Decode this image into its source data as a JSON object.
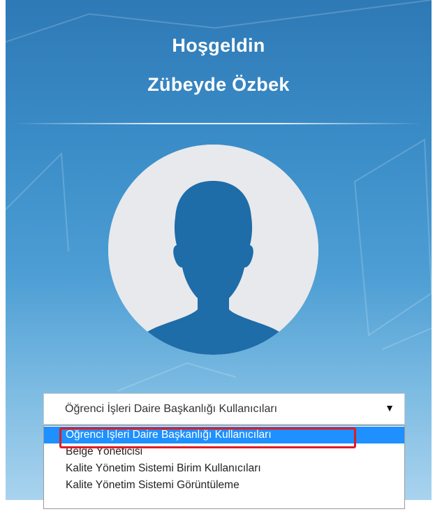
{
  "welcome": {
    "greeting": "Hoşgeldin",
    "user_name": "Zübeyde Özbek"
  },
  "avatar": {
    "icon": "user-silhouette-icon",
    "background_color": "#e7e9ec",
    "silhouette_color": "#1e6ca8"
  },
  "role_select": {
    "selected_value": "Öğrenci İşleri Daire Başkanlığı Kullanıcıları",
    "arrow_icon": "caret-down-icon",
    "arrow_glyph": "▼",
    "options": [
      {
        "label": "Öğrenci İşleri Daire Başkanlığı Kullanıcıları",
        "selected": true
      },
      {
        "label": "Belge Yöneticisi",
        "selected": false
      },
      {
        "label": "Kalite Yönetim Sistemi Birim Kullanıcıları",
        "selected": false
      },
      {
        "label": "Kalite Yönetim Sistemi Görüntüleme",
        "selected": false
      }
    ],
    "highlight_color": "#1e90ff"
  },
  "annotation": {
    "marker_color": "#e01b22"
  },
  "theme": {
    "panel_top_color": "#2e79b6",
    "panel_bottom_color": "#a9d3ee"
  }
}
